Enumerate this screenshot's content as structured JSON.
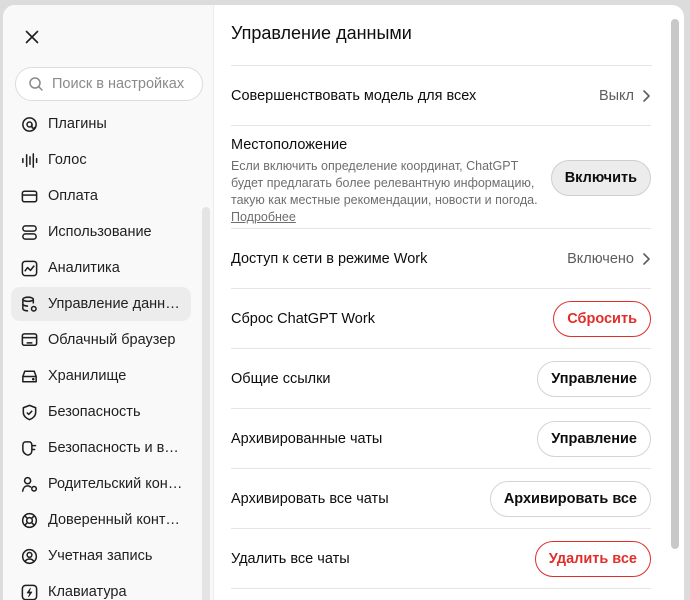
{
  "sidebar": {
    "search_placeholder": "Поиск в настройках",
    "items": [
      {
        "label": "Плагины",
        "icon": "plugins-icon"
      },
      {
        "label": "Голос",
        "icon": "voice-waveform-icon"
      },
      {
        "label": "Оплата",
        "icon": "credit-card-icon"
      },
      {
        "label": "Использование",
        "icon": "usage-stack-icon"
      },
      {
        "label": "Аналитика",
        "icon": "analytics-chart-icon"
      },
      {
        "label": "Управление данными",
        "icon": "database-gear-icon",
        "active": true
      },
      {
        "label": "Облачный браузер",
        "icon": "cloud-browser-icon"
      },
      {
        "label": "Хранилище",
        "icon": "storage-icon"
      },
      {
        "label": "Безопасность",
        "icon": "shield-icon"
      },
      {
        "label": "Безопасность и возраст",
        "icon": "shield-user-icon"
      },
      {
        "label": "Родительский контроль",
        "icon": "parental-control-icon"
      },
      {
        "label": "Доверенный контакт",
        "icon": "trusted-contact-icon"
      },
      {
        "label": "Учетная запись",
        "icon": "account-icon"
      },
      {
        "label": "Клавиатура",
        "icon": "keyboard-bolt-icon"
      }
    ]
  },
  "main": {
    "title": "Управление данными",
    "improve": {
      "label": "Совершенствовать модель для всех",
      "value": "Выкл"
    },
    "location": {
      "label": "Местоположение",
      "description": "Если включить определение координат, ChatGPT будет предлагать более релевантную информацию, такую как местные рекомендации, новости и погода.",
      "link": "Подробнее",
      "button": "Включить"
    },
    "network": {
      "label": "Доступ к сети в режиме Work",
      "value": "Включено"
    },
    "reset": {
      "label": "Сброс ChatGPT Work",
      "button": "Сбросить"
    },
    "shared_links": {
      "label": "Общие ссылки",
      "button": "Управление"
    },
    "archived_chats": {
      "label": "Архивированные чаты",
      "button": "Управление"
    },
    "archive_all": {
      "label": "Архивировать все чаты",
      "button": "Архивировать все"
    },
    "delete_all": {
      "label": "Удалить все чаты",
      "button": "Удалить все"
    }
  },
  "colors": {
    "danger": "#e02e2a",
    "text": "#0d0d0d",
    "muted": "#6e6e6e",
    "sidebar_bg": "#f9f9f9",
    "active_bg": "#ececec"
  }
}
